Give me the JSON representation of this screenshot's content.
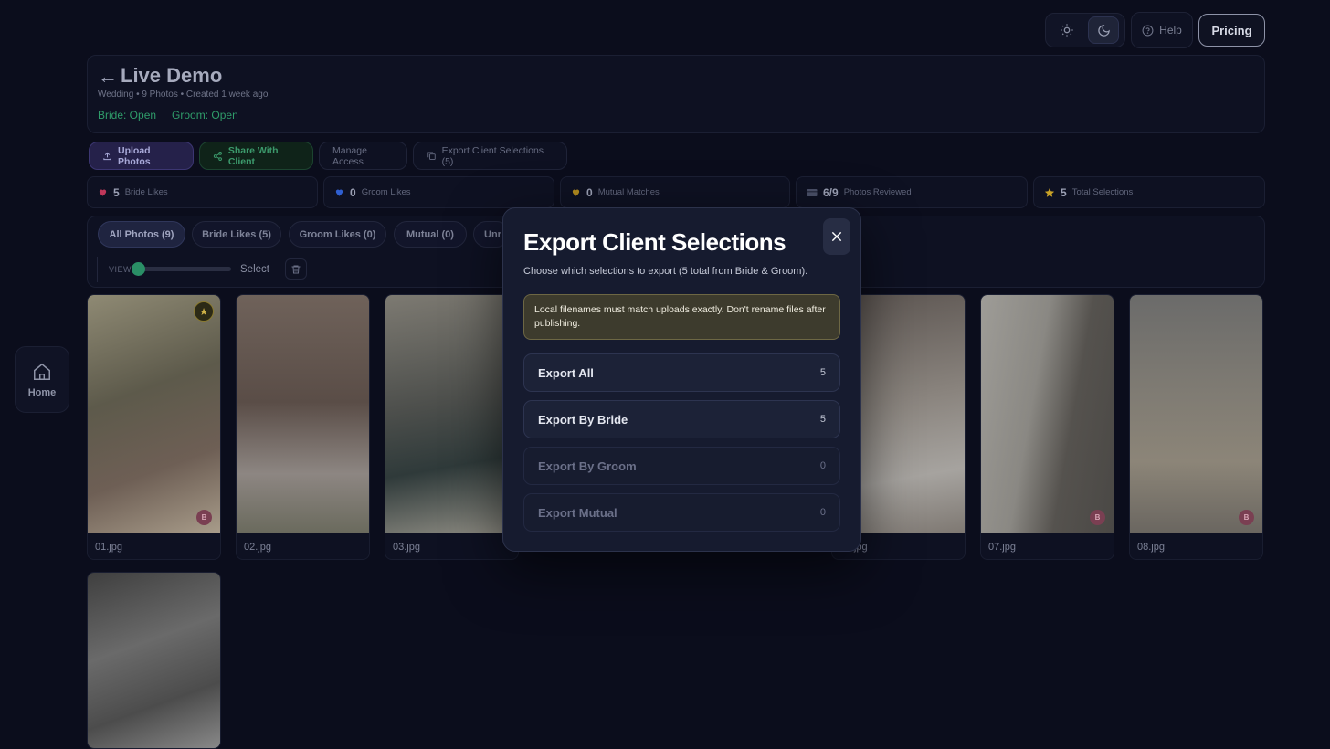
{
  "topbar": {
    "light_icon": "sun-icon",
    "dark_icon": "moon-icon",
    "help_label": "Help",
    "pricing_label": "Pricing"
  },
  "project": {
    "back_arrow": "←",
    "title": "Live Demo",
    "meta": "Wedding • 9 Photos • Created 1 week ago",
    "bride_status": "Bride: Open",
    "groom_status": "Groom: Open"
  },
  "actions": {
    "upload": "Upload Photos",
    "share": "Share With Client",
    "manage": "Manage Access",
    "export": "Export Client Selections (5)"
  },
  "stats": [
    {
      "value": "5",
      "label": "Bride Likes",
      "color": "#c0375a"
    },
    {
      "value": "0",
      "label": "Groom Likes",
      "color": "#2f5fd0"
    },
    {
      "value": "0",
      "label": "Mutual Matches",
      "color": "#b08a1e"
    },
    {
      "value": "6/9",
      "label": "Photos Reviewed",
      "color": "#5a6078"
    },
    {
      "value": "5",
      "label": "Total Selections",
      "color": "#c9a227"
    }
  ],
  "filters": {
    "chips": [
      "All Photos (9)",
      "Bride Likes (5)",
      "Groom Likes (0)",
      "Mutual (0)",
      "Unr"
    ],
    "view_label": "VIEW",
    "select_label": "Select"
  },
  "photos": [
    {
      "name": "01.jpg"
    },
    {
      "name": "02.jpg"
    },
    {
      "name": "03.jpg"
    },
    {
      "name": "jpg"
    },
    {
      "name": "07.jpg"
    },
    {
      "name": "08.jpg"
    }
  ],
  "sidebar": {
    "home_label": "Home"
  },
  "modal": {
    "title": "Export Client Selections",
    "subtitle": "Choose which selections to export (5 total from Bride & Groom).",
    "warning": "Local filenames must match uploads exactly. Don't rename files after publishing.",
    "options": [
      {
        "label": "Export All",
        "count": "5"
      },
      {
        "label": "Export By Bride",
        "count": "5"
      },
      {
        "label": "Export By Groom",
        "count": "0"
      },
      {
        "label": "Export Mutual",
        "count": "0"
      }
    ]
  }
}
